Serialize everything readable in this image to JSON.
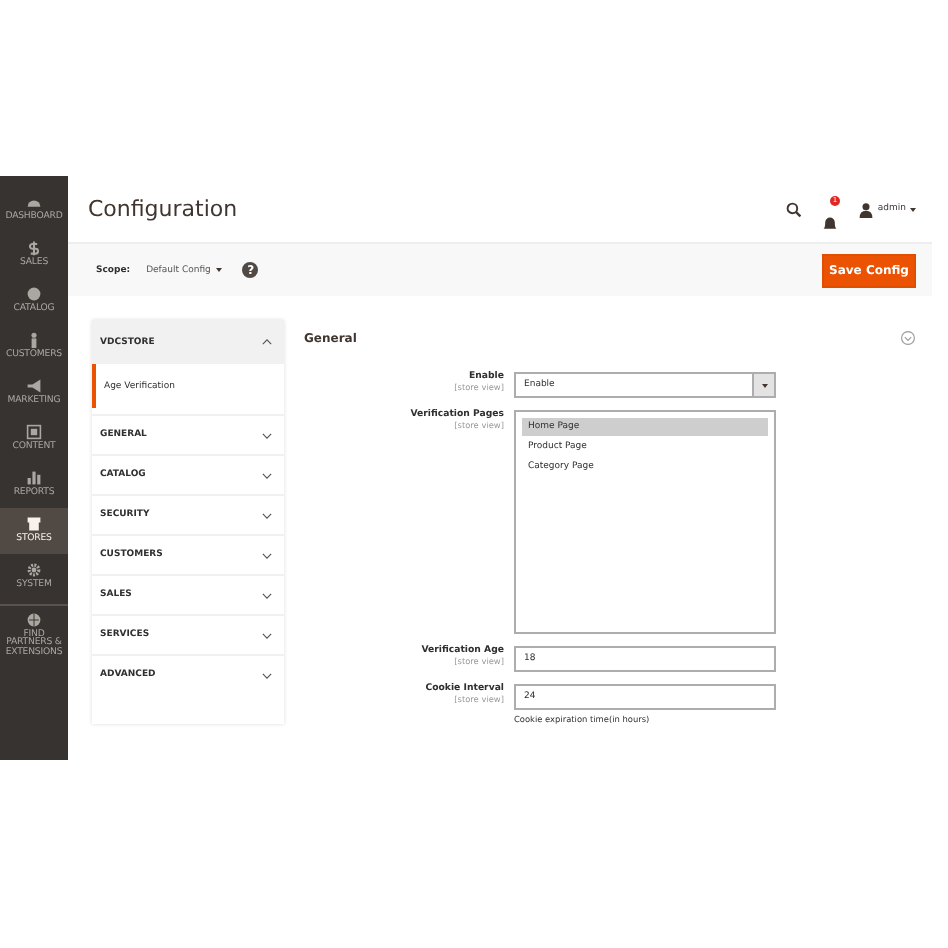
{
  "sidebar": {
    "items": [
      {
        "label": "DASHBOARD",
        "selected": false
      },
      {
        "label": "SALES",
        "selected": false
      },
      {
        "label": "CATALOG",
        "selected": false
      },
      {
        "label": "CUSTOMERS",
        "selected": false
      },
      {
        "label": "MARKETING",
        "selected": false
      },
      {
        "label": "CONTENT",
        "selected": false
      },
      {
        "label": "REPORTS",
        "selected": false
      },
      {
        "label": "STORES",
        "selected": true
      },
      {
        "label": "SYSTEM",
        "selected": false
      },
      {
        "label": "FIND PARTNERS & EXTENSIONS",
        "selected": false
      }
    ]
  },
  "header": {
    "title": "Configuration",
    "notifications": "1",
    "user": "admin"
  },
  "scope": {
    "label": "Scope:",
    "value": "Default Config",
    "help": "?"
  },
  "save_button": "Save Config",
  "config_nav": {
    "groups": [
      {
        "label": "VDCSTORE",
        "expanded": true,
        "children": [
          {
            "label": "Age Verification",
            "selected": true
          }
        ]
      },
      {
        "label": "GENERAL",
        "expanded": false
      },
      {
        "label": "CATALOG",
        "expanded": false
      },
      {
        "label": "SECURITY",
        "expanded": false
      },
      {
        "label": "CUSTOMERS",
        "expanded": false
      },
      {
        "label": "SALES",
        "expanded": false
      },
      {
        "label": "SERVICES",
        "expanded": false
      },
      {
        "label": "ADVANCED",
        "expanded": false
      }
    ]
  },
  "section": {
    "title": "General",
    "expanded": true,
    "fields": [
      {
        "kind": "select",
        "label": "Enable",
        "scope": "[store view]",
        "value": "Enable"
      },
      {
        "kind": "multiselect",
        "label": "Verification Pages",
        "scope": "[store view]",
        "options": [
          {
            "label": "Home Page",
            "selected": true
          },
          {
            "label": "Product Page",
            "selected": false
          },
          {
            "label": "Category Page",
            "selected": false
          }
        ]
      },
      {
        "kind": "text",
        "label": "Verification Age",
        "scope": "[store view]",
        "value": "18"
      },
      {
        "kind": "text",
        "label": "Cookie Interval",
        "scope": "[store view]",
        "value": "24",
        "note": "Cookie expiration time(in hours)"
      }
    ]
  }
}
